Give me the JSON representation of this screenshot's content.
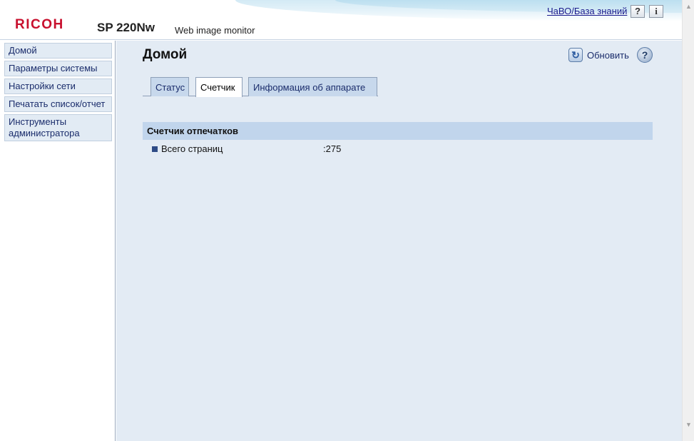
{
  "header": {
    "brand": "RICOH",
    "model": "SP 220Nw",
    "subtitle": "Web image monitor",
    "faq_link": "ЧаВО/База знаний",
    "help_button": "?",
    "info_button": "i"
  },
  "sidebar": {
    "items": [
      {
        "label": "Домой"
      },
      {
        "label": "Параметры системы"
      },
      {
        "label": "Настройки сети"
      },
      {
        "label": "Печатать список/отчет"
      },
      {
        "label": "Инструменты администратора"
      }
    ]
  },
  "main": {
    "title": "Домой",
    "refresh_label": "Обновить",
    "help_icon": "?",
    "tabs": [
      {
        "label": "Статус"
      },
      {
        "label": "Счетчик",
        "active": true
      },
      {
        "label": "Информация об аппарате"
      }
    ],
    "section": {
      "title": "Счетчик отпечатков",
      "rows": [
        {
          "label": "Всего страниц",
          "value": ":275"
        }
      ]
    }
  },
  "colors": {
    "brand_red": "#c8102e",
    "main_bg": "#e3ebf4",
    "section_bg": "#c1d5ec",
    "link_blue": "#1a1a8c"
  },
  "icons": {
    "refresh": "refresh-icon",
    "help": "question-icon",
    "info": "info-icon"
  }
}
